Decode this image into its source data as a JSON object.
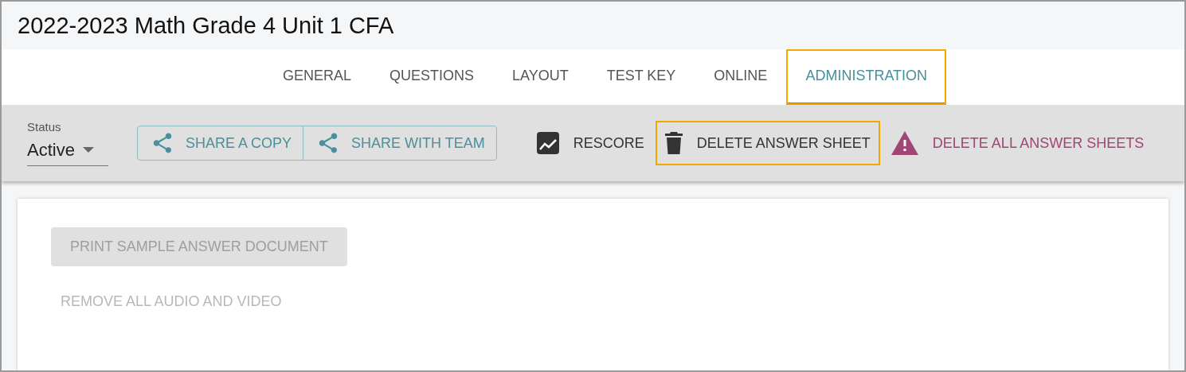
{
  "title": "2022-2023 Math Grade 4 Unit 1 CFA",
  "tabs": [
    {
      "label": "GENERAL",
      "selected": false,
      "highlighted": false
    },
    {
      "label": "QUESTIONS",
      "selected": false,
      "highlighted": false
    },
    {
      "label": "LAYOUT",
      "selected": false,
      "highlighted": false
    },
    {
      "label": "TEST KEY",
      "selected": false,
      "highlighted": false
    },
    {
      "label": "ONLINE",
      "selected": false,
      "highlighted": false
    },
    {
      "label": "ADMINISTRATION",
      "selected": true,
      "highlighted": true
    }
  ],
  "status": {
    "label": "Status",
    "value": "Active"
  },
  "share_buttons": [
    "SHARE A COPY",
    "SHARE WITH TEAM"
  ],
  "actions": [
    {
      "kind": "rescore",
      "label": "RESCORE",
      "highlighted": false
    },
    {
      "kind": "delete",
      "label": "DELETE ANSWER SHEET",
      "highlighted": true
    },
    {
      "kind": "danger",
      "label": "DELETE ALL ANSWER SHEETS",
      "highlighted": false
    }
  ],
  "print_button": {
    "label": "PRINT SAMPLE ANSWER DOCUMENT",
    "disabled": true
  },
  "remove_link": {
    "label": "REMOVE ALL AUDIO AND VIDEO",
    "disabled": true
  }
}
